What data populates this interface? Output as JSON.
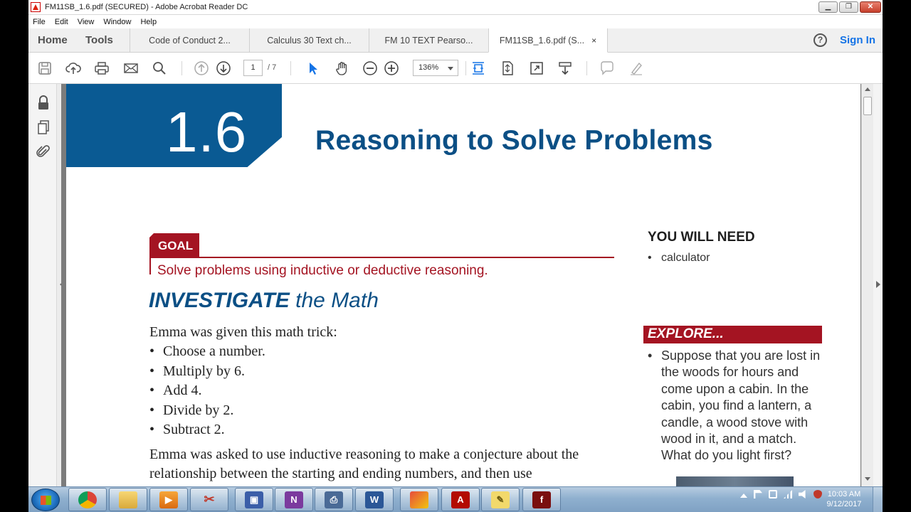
{
  "window": {
    "title": "FM11SB_1.6.pdf (SECURED) - Adobe Acrobat Reader DC",
    "minimize": "▁",
    "maximize": "❐",
    "close": "✕"
  },
  "menu": [
    "File",
    "Edit",
    "View",
    "Window",
    "Help"
  ],
  "nav": {
    "home": "Home",
    "tools": "Tools",
    "tabs": [
      {
        "label": "Code of Conduct 2..."
      },
      {
        "label": "Calculus 30 Text ch..."
      },
      {
        "label": "FM 10 TEXT Pearso..."
      },
      {
        "label": "FM11SB_1.6.pdf (S...",
        "active": true
      }
    ],
    "tab_close": "×",
    "help": "?",
    "sign_in": "Sign In"
  },
  "toolbar": {
    "page_current": "1",
    "page_total": "/ 7",
    "zoom": "136%"
  },
  "document": {
    "chapter_number": "1.6",
    "title": "Reasoning to Solve Problems",
    "goal_label": "GOAL",
    "goal_text": "Solve problems using inductive or deductive reasoning.",
    "section_bold": "INVESTIGATE",
    "section_rest": "the Math",
    "intro": "Emma was given this math trick:",
    "steps": [
      "Choose a number.",
      "Multiply by 6.",
      "Add 4.",
      "Divide by 2.",
      "Subtract 2."
    ],
    "paragraph": "Emma was asked to use inductive reasoning to make a conjecture about the relationship between the starting and ending numbers, and then use",
    "you_will_need": "YOU WILL NEED",
    "need_items": [
      "calculator"
    ],
    "explore_label": "EXPLORE...",
    "explore_text": "Suppose that you are lost in the woods for hours and come upon a cabin. In the cabin, you find a lantern, a candle, a wood stove with wood in it, and a match. What do you light first?"
  },
  "taskbar": {
    "time": "10:03 AM",
    "date": "9/12/2017",
    "apps": [
      "chrome",
      "explorer",
      "media-player",
      "snipping-tool",
      "save",
      "onenote",
      "fax",
      "word",
      "paint",
      "acrobat",
      "sticky-notes",
      "flash"
    ]
  },
  "colors": {
    "accent_blue": "#0b4f85",
    "accent_red": "#a41422",
    "sign_in_blue": "#1473e6"
  }
}
